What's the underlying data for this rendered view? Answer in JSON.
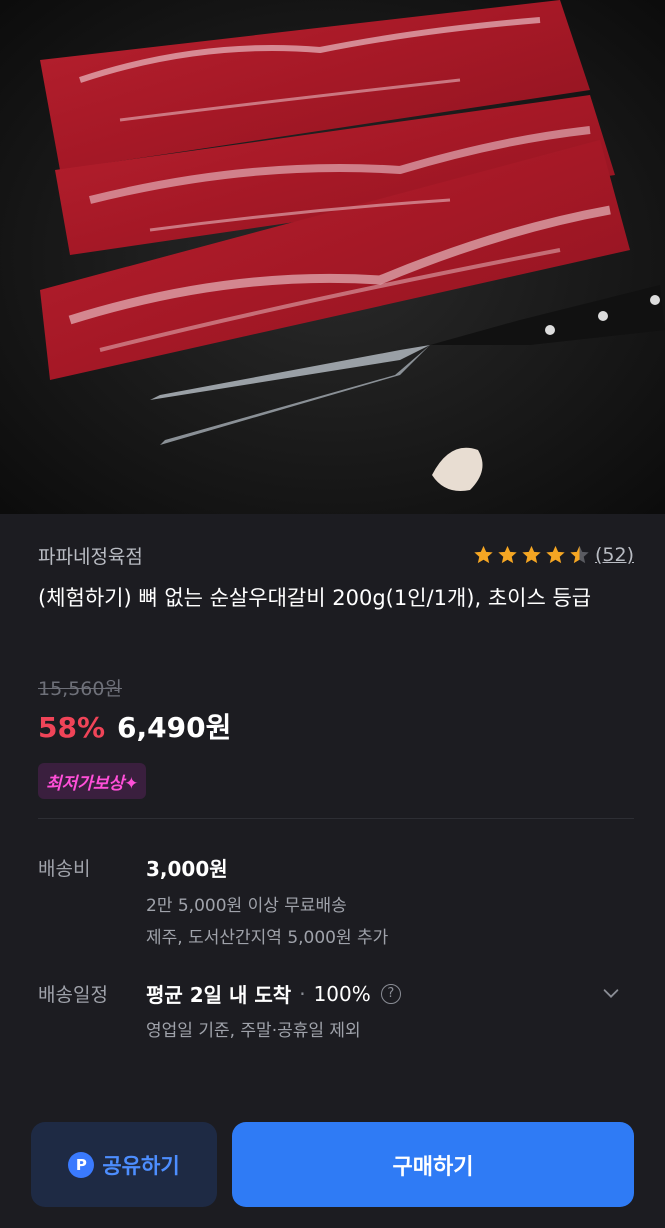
{
  "product": {
    "image_alt": "boneless beef short rib strips with carving fork",
    "seller": "파파네정육점",
    "rating": 4.5,
    "review_count": "(52)",
    "title": "(체험하기) 뼈 없는 순살우대갈비 200g(1인/1개), 초이스 등급",
    "original_price": "15,560원",
    "discount": "58%",
    "price": "6,490원",
    "badge": "최저가보상✦"
  },
  "shipping": {
    "fee_label": "배송비",
    "fee_value": "3,000원",
    "fee_note1": "2만 5,000원 이상 무료배송",
    "fee_note2": "제주, 도서산간지역 5,000원 추가",
    "schedule_label": "배송일정",
    "schedule_value": "평균 2일 내 도착",
    "schedule_rate": "100%",
    "schedule_note": "영업일 기준, 주말·공휴일 제외"
  },
  "actions": {
    "share_label": "공유하기",
    "buy_label": "구매하기"
  },
  "colors": {
    "background": "#1c1c21",
    "discount": "#f04458",
    "star": "#f5a623",
    "buy_button": "#2f7bf5",
    "badge_text": "#ff4fd8"
  },
  "icons": [
    "star-icon",
    "help-icon",
    "chevron-down-icon",
    "naver-pay-icon"
  ]
}
